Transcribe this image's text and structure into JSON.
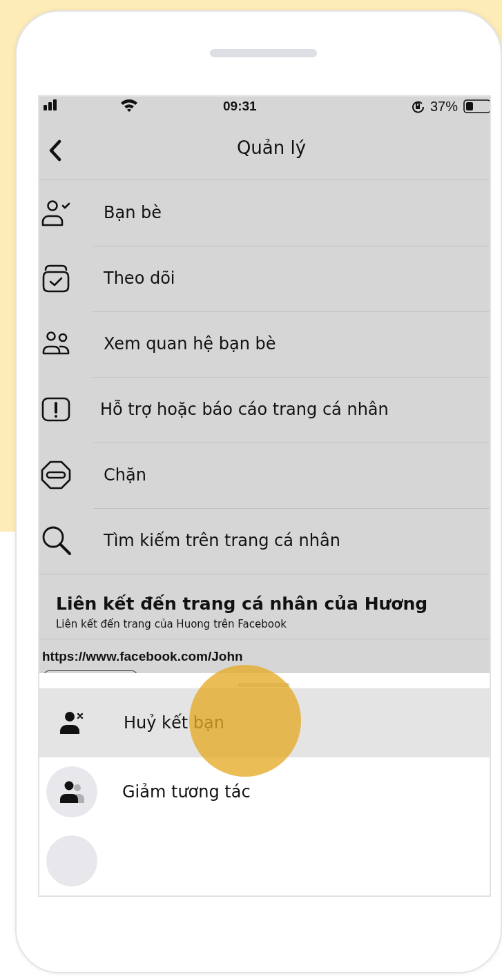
{
  "status_bar": {
    "time": "09:31",
    "battery": "37%"
  },
  "header": {
    "title": "Quản lý"
  },
  "menu": [
    {
      "kind": "friends",
      "label": "Bạn bè"
    },
    {
      "kind": "following",
      "label": "Theo dõi"
    },
    {
      "kind": "mutual",
      "label": "Xem quan hệ bạn bè"
    },
    {
      "kind": "report",
      "label": "Hỗ trợ hoặc báo cáo trang cá nhân"
    },
    {
      "kind": "block",
      "label": "Chặn"
    },
    {
      "kind": "search",
      "label": "Tìm kiếm trên trang cá nhân"
    }
  ],
  "profile_link": {
    "title": "Liên kết đến trang cá nhân của Hương",
    "subtitle": "Liên kết đến trang của Huong trên Facebook",
    "url": "https://www.facebook.com/John"
  },
  "action_sheet": [
    {
      "kind": "unfriend",
      "label": "Huỷ kết bạn",
      "selected": true
    },
    {
      "kind": "reduce",
      "label": "Giảm tương tác",
      "selected": false
    }
  ]
}
